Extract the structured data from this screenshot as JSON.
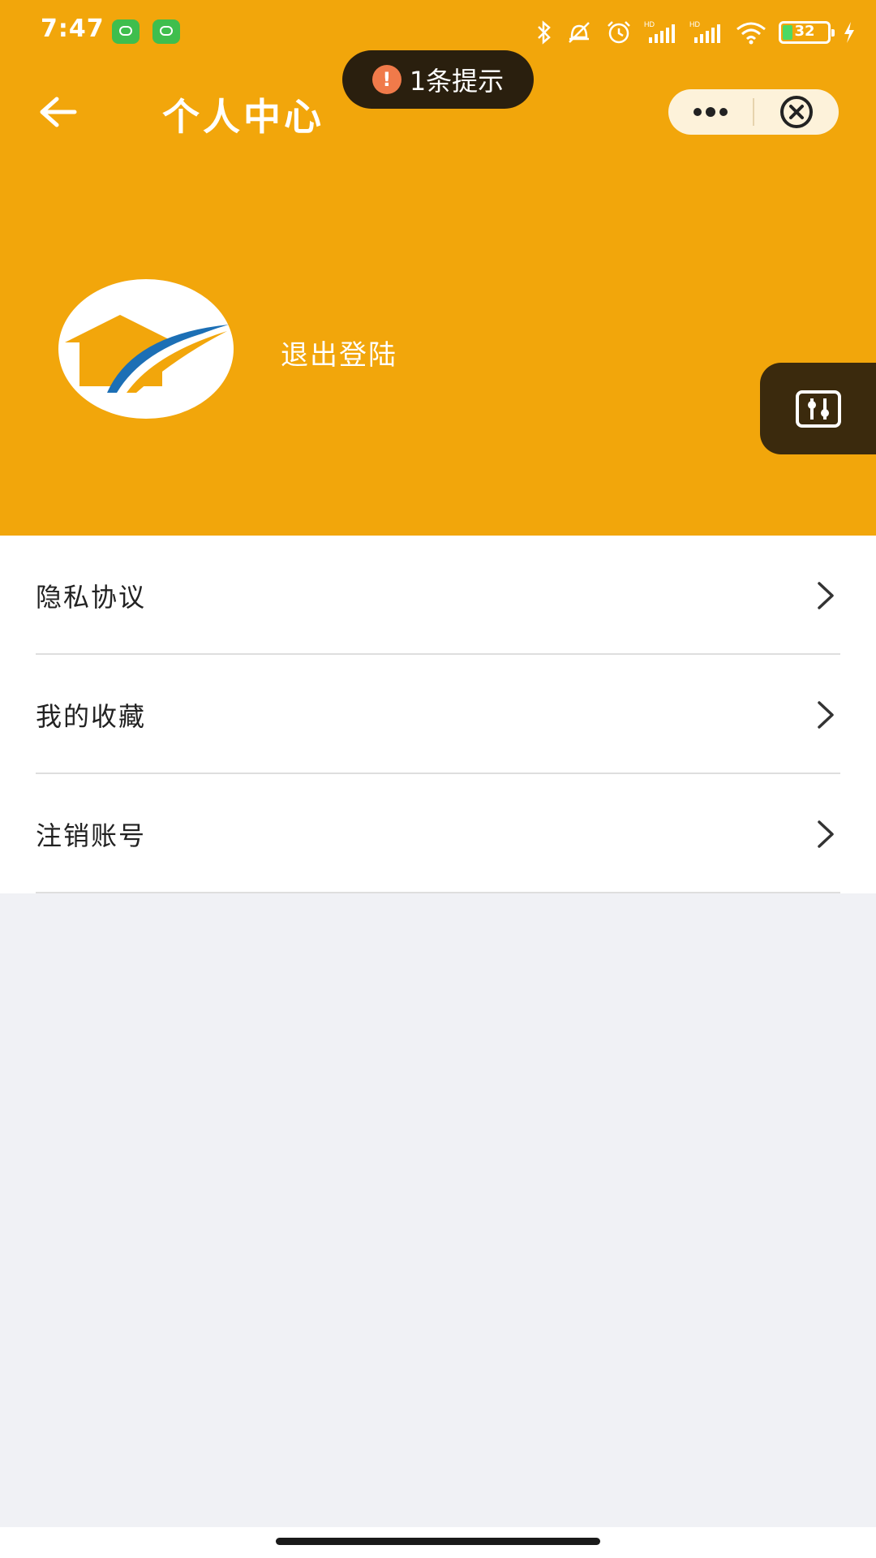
{
  "status_bar": {
    "time": "7:47",
    "battery_percent": "32",
    "icons": [
      "app-notification-icon",
      "app-notification-icon",
      "bluetooth-icon",
      "mute-icon",
      "alarm-icon",
      "signal-hd-icon",
      "signal-hd-icon",
      "wifi-icon",
      "battery-icon",
      "charging-icon"
    ]
  },
  "toast": {
    "text": "1条提示",
    "icon": "warning-icon",
    "icon_glyph": "!"
  },
  "nav": {
    "title": "个人中心",
    "back_icon": "back-arrow-icon",
    "more_icon": "more-dots-icon",
    "close_icon": "close-circle-icon"
  },
  "profile": {
    "action_label": "退出登陆",
    "avatar": "house-logo"
  },
  "menu": {
    "items": [
      {
        "label": "隐私协议"
      },
      {
        "label": "我的收藏"
      },
      {
        "label": "注销账号"
      }
    ]
  },
  "colors": {
    "header": "#f2a60b",
    "page_bg": "#f0f1f5",
    "toast_bg": "#2a1f0e",
    "capsule_bg": "#fdf2da",
    "float_tool_bg": "#3b2a0d"
  }
}
